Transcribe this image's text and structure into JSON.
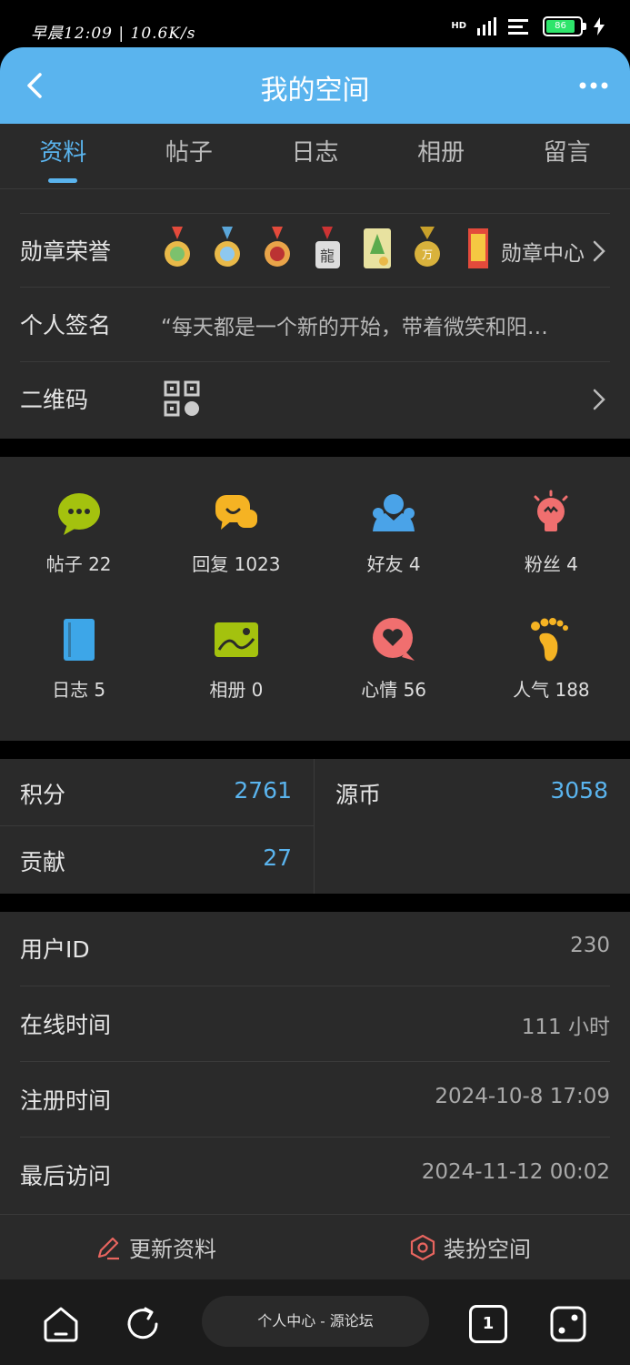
{
  "status_bar": {
    "time_speed": "早晨12:09 | 10.6K/s",
    "network": "HD",
    "battery": "86"
  },
  "header": {
    "title": "我的空间"
  },
  "tabs": [
    {
      "label": "资料",
      "active": true
    },
    {
      "label": "帖子",
      "active": false
    },
    {
      "label": "日志",
      "active": false
    },
    {
      "label": "相册",
      "active": false
    },
    {
      "label": "留言",
      "active": false
    }
  ],
  "profile": {
    "medals_label": "勋章荣誉",
    "medal_center_link": "勋章中心",
    "medal_icons": [
      "medal-flower-icon",
      "medal-star-icon",
      "medal-heart-icon",
      "medal-dragon-icon",
      "medal-scroll-icon",
      "medal-gold-icon",
      "medal-banner-icon"
    ],
    "signature_label": "个人签名",
    "signature_value": "“每天都是一个新的开始，带着微笑和阳…",
    "qrcode_label": "二维码"
  },
  "stats": [
    {
      "label": "帖子 22",
      "icon": "chat-bubble-icon",
      "color": "#a4c20e"
    },
    {
      "label": "回复 1023",
      "icon": "reply-bubbles-icon",
      "color": "#f5b323"
    },
    {
      "label": "好友 4",
      "icon": "friends-icon",
      "color": "#4aa3e8"
    },
    {
      "label": "粉丝 4",
      "icon": "lightbulb-icon",
      "color": "#f06f6f"
    },
    {
      "label": "日志 5",
      "icon": "notebook-icon",
      "color": "#3da6e8"
    },
    {
      "label": "相册 0",
      "icon": "picture-icon",
      "color": "#a4c20e"
    },
    {
      "label": "心情 56",
      "icon": "heart-bubble-icon",
      "color": "#f06f6f"
    },
    {
      "label": "人气 188",
      "icon": "footprint-icon",
      "color": "#f5b323"
    }
  ],
  "points": {
    "score_label": "积分",
    "score_value": "2761",
    "coin_label": "源币",
    "coin_value": "3058",
    "contrib_label": "贡献",
    "contrib_value": "27"
  },
  "info": [
    {
      "label": "用户ID",
      "value": "230"
    },
    {
      "label": "在线时间",
      "value": "111 小时"
    },
    {
      "label": "注册时间",
      "value": "2024-10-8 17:09"
    },
    {
      "label": "最后访问",
      "value": "2024-11-12 00:02"
    }
  ],
  "actions": {
    "update_label": "更新资料",
    "dress_label": "装扮空间"
  },
  "bottom_nav": {
    "pill_text": "个人中心 - 源论坛",
    "tab_count": "1"
  },
  "colors": {
    "accent": "#5ab4ee",
    "background": "#2a2a2a"
  }
}
